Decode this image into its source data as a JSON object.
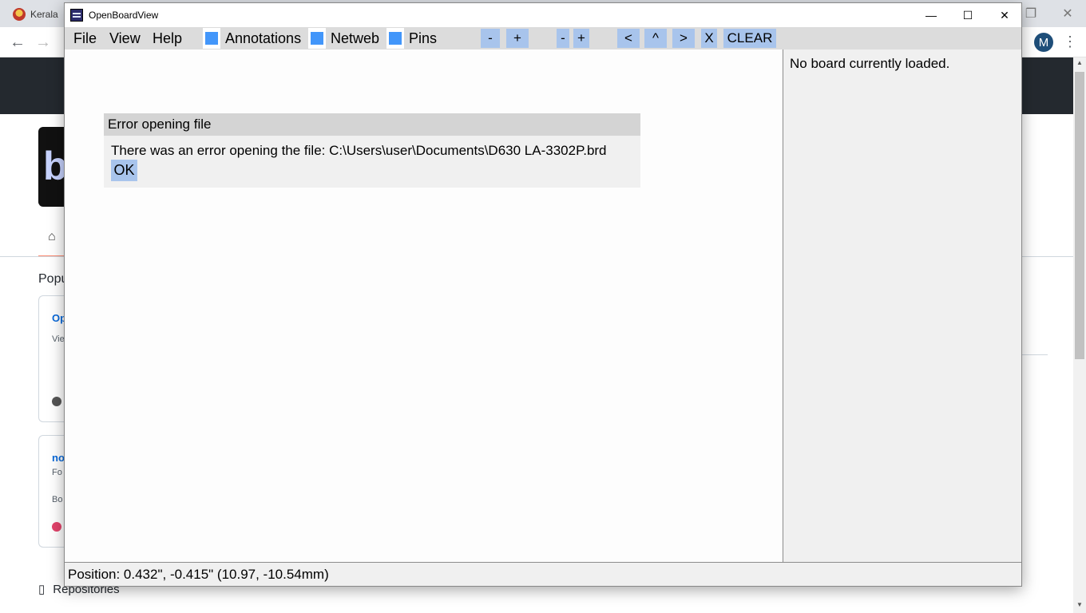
{
  "browser": {
    "tab_title": "Kerala",
    "window_controls": {
      "minimize": "—",
      "restore": "❐",
      "close": "✕"
    },
    "nav": {
      "back": "←",
      "forward": "→"
    },
    "avatar_letter": "M",
    "logo_letter": "b",
    "popular_label": "Popu",
    "card1": {
      "title": "Op",
      "subtitle": "Vie"
    },
    "card2": {
      "title": "no",
      "subtitle1": "Fo",
      "subtitle2": "Bo"
    },
    "repositories_label": "Repositories",
    "colors": {
      "header": "#24292f",
      "dot1": "#555555",
      "dot2": "#e3436b",
      "link": "#0969da"
    }
  },
  "obv": {
    "title": "OpenBoardView",
    "controls": {
      "minimize": "—",
      "maximize": "☐",
      "close": "✕"
    },
    "menu": {
      "file": "File",
      "view": "View",
      "help": "Help"
    },
    "checkboxes": [
      {
        "label": "Annotations",
        "checked": true
      },
      {
        "label": "Netweb",
        "checked": true
      },
      {
        "label": "Pins",
        "checked": true
      }
    ],
    "toolbar": {
      "zoom_out": "-",
      "zoom_in": "+",
      "step_down": "-",
      "step_up": "+",
      "prev": "<",
      "up": "^",
      "next": ">",
      "close": "X",
      "clear": "CLEAR"
    },
    "side_panel": {
      "message": "No board currently loaded."
    },
    "error_dialog": {
      "title": "Error opening file",
      "message": "There was an error opening the file: C:\\Users\\user\\Documents\\D630 LA-3302P.brd",
      "ok": "OK"
    },
    "status": "Position: 0.432\", -0.415\" (10.97, -10.54mm)",
    "colors": {
      "menubar": "#dcdcdc",
      "button": "#a8c4ec",
      "checkbox": "#4296fa",
      "panel": "#f0f0f0"
    }
  }
}
